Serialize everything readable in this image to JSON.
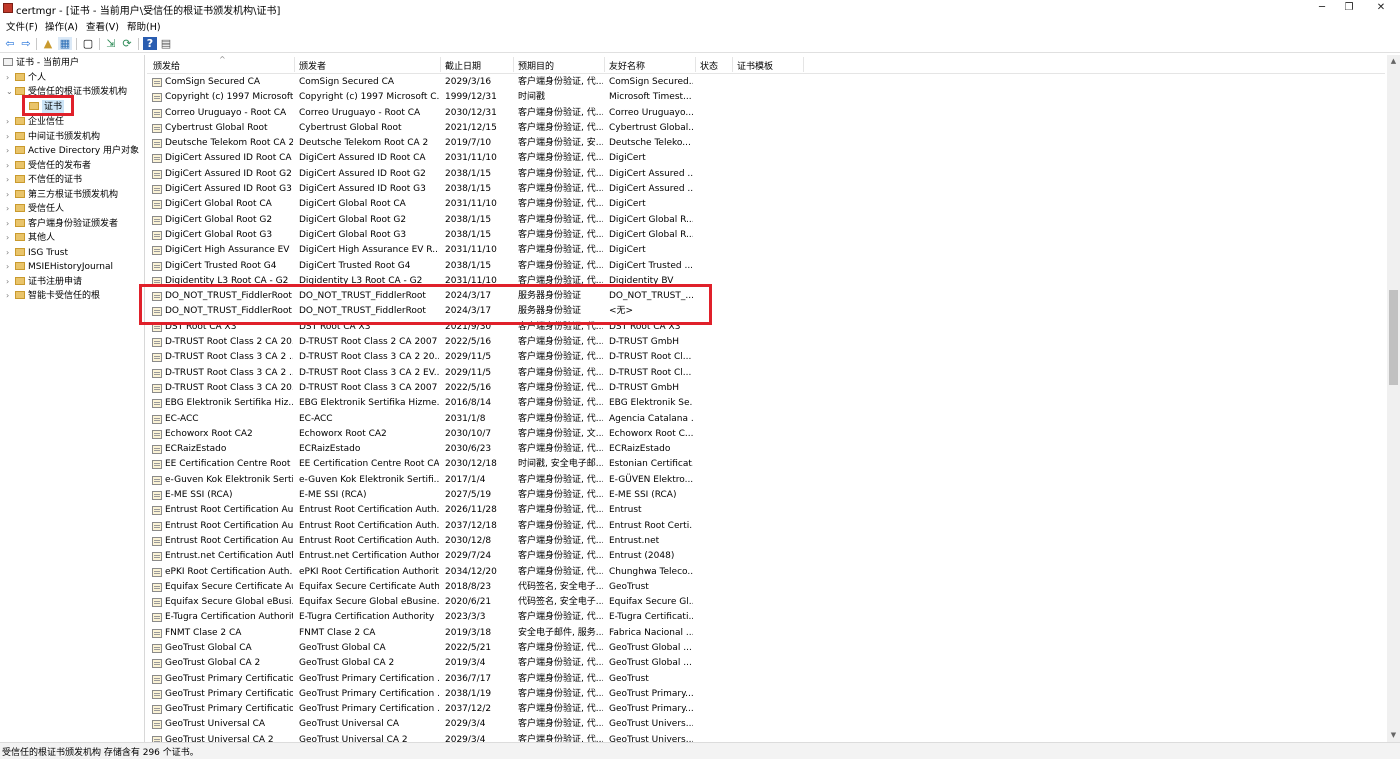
{
  "window": {
    "title": "certmgr - [证书 - 当前用户\\受信任的根证书颁发机构\\证书]",
    "minimize": "─",
    "maximize": "❐",
    "close": "✕"
  },
  "menu": [
    "文件(F)",
    "操作(A)",
    "查看(V)",
    "帮助(H)"
  ],
  "toolbar": {
    "back": "⇦",
    "forward": "⇨",
    "up": "▲",
    "show_tree": "▦",
    "copy": "▢",
    "export": "⇲",
    "refresh": "⟳",
    "help": "?",
    "properties": "▤"
  },
  "tree": {
    "root": "证书 - 当前用户",
    "items": [
      {
        "label": "个人",
        "expander": "›"
      },
      {
        "label": "受信任的根证书颁发机构",
        "expander": "⌄"
      },
      {
        "label": "证书",
        "expander": ""
      },
      {
        "label": "企业信任",
        "expander": "›"
      },
      {
        "label": "中间证书颁发机构",
        "expander": "›"
      },
      {
        "label": "Active Directory 用户对象",
        "expander": "›"
      },
      {
        "label": "受信任的发布者",
        "expander": "›"
      },
      {
        "label": "不信任的证书",
        "expander": "›"
      },
      {
        "label": "第三方根证书颁发机构",
        "expander": "›"
      },
      {
        "label": "受信任人",
        "expander": "›"
      },
      {
        "label": "客户端身份验证颁发者",
        "expander": "›"
      },
      {
        "label": "其他人",
        "expander": "›"
      },
      {
        "label": "ISG Trust",
        "expander": "›"
      },
      {
        "label": "MSIEHistoryJournal",
        "expander": "›"
      },
      {
        "label": "证书注册申请",
        "expander": "›"
      },
      {
        "label": "智能卡受信任的根",
        "expander": "›"
      }
    ]
  },
  "list": {
    "sort_indicator": "^",
    "columns": [
      "颁发给",
      "颁发者",
      "截止日期",
      "预期目的",
      "友好名称",
      "状态",
      "证书模板"
    ],
    "rows": [
      [
        "ComSign Secured CA",
        "ComSign Secured CA",
        "2029/3/16",
        "客户端身份验证, 代...",
        "ComSign Secured..."
      ],
      [
        "Copyright (c) 1997 Microsoft...",
        "Copyright (c) 1997 Microsoft C...",
        "1999/12/31",
        "时间戳",
        "Microsoft Timest..."
      ],
      [
        "Correo Uruguayo - Root CA",
        "Correo Uruguayo - Root CA",
        "2030/12/31",
        "客户端身份验证, 代...",
        "Correo Uruguayo..."
      ],
      [
        "Cybertrust Global Root",
        "Cybertrust Global Root",
        "2021/12/15",
        "客户端身份验证, 代...",
        "Cybertrust Global..."
      ],
      [
        "Deutsche Telekom Root CA 2",
        "Deutsche Telekom Root CA 2",
        "2019/7/10",
        "客户端身份验证, 安...",
        "Deutsche Teleko..."
      ],
      [
        "DigiCert Assured ID Root CA",
        "DigiCert Assured ID Root CA",
        "2031/11/10",
        "客户端身份验证, 代...",
        "DigiCert"
      ],
      [
        "DigiCert Assured ID Root G2",
        "DigiCert Assured ID Root G2",
        "2038/1/15",
        "客户端身份验证, 代...",
        "DigiCert Assured ..."
      ],
      [
        "DigiCert Assured ID Root G3",
        "DigiCert Assured ID Root G3",
        "2038/1/15",
        "客户端身份验证, 代...",
        "DigiCert Assured ..."
      ],
      [
        "DigiCert Global Root CA",
        "DigiCert Global Root CA",
        "2031/11/10",
        "客户端身份验证, 代...",
        "DigiCert"
      ],
      [
        "DigiCert Global Root G2",
        "DigiCert Global Root G2",
        "2038/1/15",
        "客户端身份验证, 代...",
        "DigiCert Global R..."
      ],
      [
        "DigiCert Global Root G3",
        "DigiCert Global Root G3",
        "2038/1/15",
        "客户端身份验证, 代...",
        "DigiCert Global R..."
      ],
      [
        "DigiCert High Assurance EV ...",
        "DigiCert High Assurance EV R...",
        "2031/11/10",
        "客户端身份验证, 代...",
        "DigiCert"
      ],
      [
        "DigiCert Trusted Root G4",
        "DigiCert Trusted Root G4",
        "2038/1/15",
        "客户端身份验证, 代...",
        "DigiCert Trusted ..."
      ],
      [
        "Digidentity L3 Root CA - G2",
        "Digidentity L3 Root CA - G2",
        "2031/11/10",
        "客户端身份验证, 代...",
        "Digidentity BV"
      ],
      [
        "DO_NOT_TRUST_FiddlerRoot",
        "DO_NOT_TRUST_FiddlerRoot",
        "2024/3/17",
        "服务器身份验证",
        "DO_NOT_TRUST_..."
      ],
      [
        "DO_NOT_TRUST_FiddlerRoot",
        "DO_NOT_TRUST_FiddlerRoot",
        "2024/3/17",
        "服务器身份验证",
        "<无>"
      ],
      [
        "DST Root CA X3",
        "DST Root CA X3",
        "2021/9/30",
        "客户端身份验证, 代...",
        "DST Root CA X3"
      ],
      [
        "D-TRUST Root Class 2 CA 20...",
        "D-TRUST Root Class 2 CA 2007",
        "2022/5/16",
        "客户端身份验证, 代...",
        "D-TRUST GmbH"
      ],
      [
        "D-TRUST Root Class 3 CA 2 ...",
        "D-TRUST Root Class 3 CA 2 20...",
        "2029/11/5",
        "客户端身份验证, 代...",
        "D-TRUST Root Cl..."
      ],
      [
        "D-TRUST Root Class 3 CA 2 ...",
        "D-TRUST Root Class 3 CA 2 EV...",
        "2029/11/5",
        "客户端身份验证, 代...",
        "D-TRUST Root Cl..."
      ],
      [
        "D-TRUST Root Class 3 CA 20...",
        "D-TRUST Root Class 3 CA 2007",
        "2022/5/16",
        "客户端身份验证, 代...",
        "D-TRUST GmbH"
      ],
      [
        "EBG Elektronik Sertifika Hiz...",
        "EBG Elektronik Sertifika Hizme...",
        "2016/8/14",
        "客户端身份验证, 代...",
        "EBG Elektronik Se..."
      ],
      [
        "EC-ACC",
        "EC-ACC",
        "2031/1/8",
        "客户端身份验证, 代...",
        "Agencia Catalana ..."
      ],
      [
        "Echoworx Root CA2",
        "Echoworx Root CA2",
        "2030/10/7",
        "客户端身份验证, 文...",
        "Echoworx Root C..."
      ],
      [
        "ECRaizEstado",
        "ECRaizEstado",
        "2030/6/23",
        "客户端身份验证, 代...",
        "ECRaizEstado"
      ],
      [
        "EE Certification Centre Root ...",
        "EE Certification Centre Root CA",
        "2030/12/18",
        "时间戳, 安全电子邮...",
        "Estonian Certificat..."
      ],
      [
        "e-Guven Kok Elektronik Serti...",
        "e-Guven Kok Elektronik Sertifi...",
        "2017/1/4",
        "客户端身份验证, 代...",
        "E-GÜVEN Elektro..."
      ],
      [
        "E-ME SSI (RCA)",
        "E-ME SSI (RCA)",
        "2027/5/19",
        "客户端身份验证, 代...",
        "E-ME SSI (RCA)"
      ],
      [
        "Entrust Root Certification Au...",
        "Entrust Root Certification Auth...",
        "2026/11/28",
        "客户端身份验证, 代...",
        "Entrust"
      ],
      [
        "Entrust Root Certification Au...",
        "Entrust Root Certification Auth...",
        "2037/12/18",
        "客户端身份验证, 代...",
        "Entrust Root Certi..."
      ],
      [
        "Entrust Root Certification Au...",
        "Entrust Root Certification Auth...",
        "2030/12/8",
        "客户端身份验证, 代...",
        "Entrust.net"
      ],
      [
        "Entrust.net Certification Auth...",
        "Entrust.net Certification Author...",
        "2029/7/24",
        "客户端身份验证, 代...",
        "Entrust (2048)"
      ],
      [
        "ePKI Root Certification Auth...",
        "ePKI Root Certification Authority",
        "2034/12/20",
        "客户端身份验证, 代...",
        "Chunghwa Teleco..."
      ],
      [
        "Equifax Secure Certificate Au...",
        "Equifax Secure Certificate Auth...",
        "2018/8/23",
        "代码签名, 安全电子...",
        "GeoTrust"
      ],
      [
        "Equifax Secure Global eBusi...",
        "Equifax Secure Global eBusine...",
        "2020/6/21",
        "代码签名, 安全电子...",
        "Equifax Secure Gl..."
      ],
      [
        "E-Tugra Certification Authority",
        "E-Tugra Certification Authority",
        "2023/3/3",
        "客户端身份验证, 代...",
        "E-Tugra Certificati..."
      ],
      [
        "FNMT Clase 2 CA",
        "FNMT Clase 2 CA",
        "2019/3/18",
        "安全电子邮件, 服务...",
        "Fabrica Nacional ..."
      ],
      [
        "GeoTrust Global CA",
        "GeoTrust Global CA",
        "2022/5/21",
        "客户端身份验证, 代...",
        "GeoTrust Global ..."
      ],
      [
        "GeoTrust Global CA 2",
        "GeoTrust Global CA 2",
        "2019/3/4",
        "客户端身份验证, 代...",
        "GeoTrust Global ..."
      ],
      [
        "GeoTrust Primary Certificatio...",
        "GeoTrust Primary Certification ...",
        "2036/7/17",
        "客户端身份验证, 代...",
        "GeoTrust"
      ],
      [
        "GeoTrust Primary Certificatio...",
        "GeoTrust Primary Certification ...",
        "2038/1/19",
        "客户端身份验证, 代...",
        "GeoTrust Primary..."
      ],
      [
        "GeoTrust Primary Certificatio...",
        "GeoTrust Primary Certification ...",
        "2037/12/2",
        "客户端身份验证, 代...",
        "GeoTrust Primary..."
      ],
      [
        "GeoTrust Universal CA",
        "GeoTrust Universal CA",
        "2029/3/4",
        "客户端身份验证, 代...",
        "GeoTrust Univers..."
      ],
      [
        "GeoTrust Universal CA 2",
        "GeoTrust Universal CA 2",
        "2029/3/4",
        "客户端身份验证, 代...",
        "GeoTrust Univers..."
      ]
    ]
  },
  "scrollbar": {
    "up": "▲",
    "down": "▼"
  },
  "status": "受信任的根证书颁发机构 存储含有 296 个证书。",
  "colors": {
    "annotation": "#e0202a",
    "selection": "#cce4f7"
  }
}
